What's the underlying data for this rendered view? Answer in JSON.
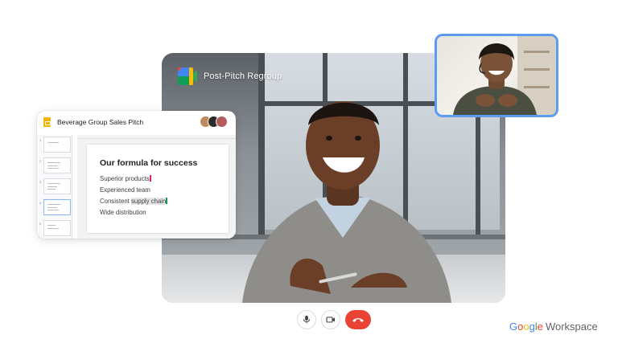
{
  "meeting": {
    "title": "Post-Pitch Regroup"
  },
  "document": {
    "title": "Beverage Group Sales Pitch",
    "slide_heading": "Our formula for success",
    "bullets": [
      "Superior products",
      "Experienced team",
      "Consistent ",
      "supply chain",
      "Wide distribution"
    ],
    "thumbnail_numbers": [
      "1",
      "2",
      "3",
      "4",
      "5"
    ]
  },
  "controls": {
    "mic_icon": "microphone-icon",
    "camera_icon": "video-camera-icon",
    "end_icon": "end-call-icon"
  },
  "brand": {
    "google_letters": [
      "G",
      "o",
      "o",
      "g",
      "l",
      "e"
    ],
    "google_colors": [
      "#4285f4",
      "#ea4335",
      "#fbbc05",
      "#4285f4",
      "#34a853",
      "#ea4335"
    ],
    "product": "Workspace"
  },
  "colors": {
    "end_call": "#ea4335",
    "self_view_border": "#5b9bf0",
    "slides_icon": "#f4b400",
    "cursor_pink": "#e91e63",
    "cursor_green": "#0f9d58"
  }
}
